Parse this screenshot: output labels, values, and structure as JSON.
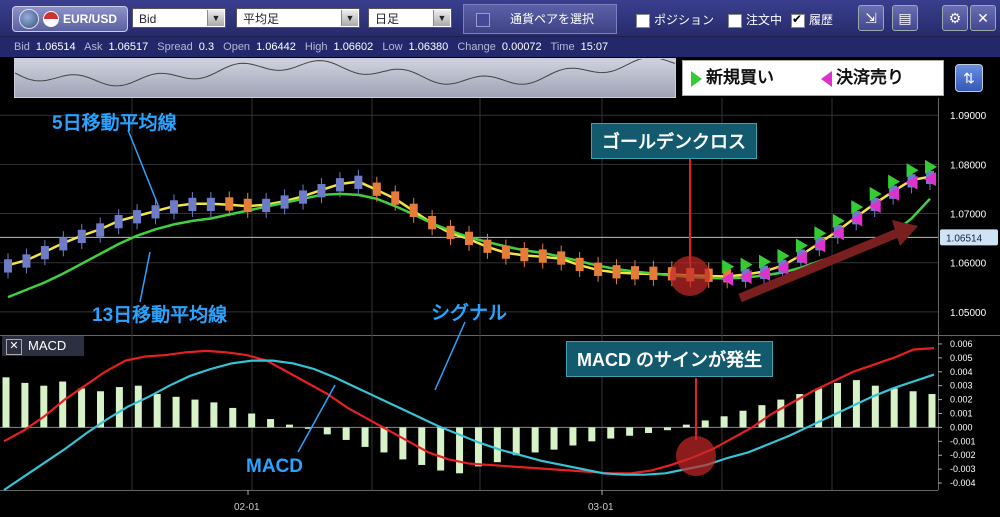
{
  "toolbar": {
    "pair": "EUR/USD",
    "price_type": "Bid",
    "chart_type": "平均足",
    "timeframe": "日足",
    "pair_select_label": "通貨ペアを選択",
    "position_label": "ポジション",
    "position_checked": false,
    "orders_label": "注文中",
    "orders_checked": false,
    "history_label": "履歴",
    "history_checked": true
  },
  "quote": {
    "bid_label": "Bid",
    "bid": "1.06514",
    "ask_label": "Ask",
    "ask": "1.06517",
    "spread_label": "Spread",
    "spread": "0.3",
    "open_label": "Open",
    "open": "1.06442",
    "high_label": "High",
    "high": "1.06602",
    "low_label": "Low",
    "low": "1.06380",
    "change_label": "Change",
    "change": "0.00072",
    "time_label": "Time",
    "time": "15:07"
  },
  "order_panel": {
    "buy_label": "新規買い",
    "sell_label": "決済売り"
  },
  "annotations": {
    "ma5": "5日移動平均線",
    "ma13": "13日移動平均線",
    "golden_cross": "ゴールデンクロス",
    "signal": "シグナル",
    "macd_sign": "MACD のサインが発生",
    "macd": "MACD"
  },
  "macd_tag": "MACD",
  "colors": {
    "up_candle": "#6e7bc9",
    "down_candle": "#e57d3a",
    "ma5": "#f2e441",
    "ma13": "#3fd13f",
    "macd_line": "#e62020",
    "signal_line": "#35c4d6",
    "histogram": "#d6f2c6",
    "buy": "#33cc33",
    "sell": "#dd33cc"
  },
  "chart_data": [
    {
      "type": "candlestick",
      "title": "",
      "y_ticks": [
        "1.09000",
        "1.08000",
        "1.07000",
        "1.06000",
        "1.05000"
      ],
      "ylim": [
        1.0455,
        1.0935
      ],
      "current_price": "1.06514",
      "series": [
        {
          "name": "5日移動平均線",
          "values": [
            1.0595,
            1.0605,
            1.0622,
            1.064,
            1.0655,
            1.0668,
            1.0685,
            1.0695,
            1.0705,
            1.0715,
            1.072,
            1.072,
            1.0718,
            1.0715,
            1.0718,
            1.0725,
            1.0735,
            1.0748,
            1.076,
            1.0765,
            1.0748,
            1.073,
            1.0705,
            1.068,
            1.066,
            1.0648,
            1.0632,
            1.062,
            1.0615,
            1.0612,
            1.0608,
            1.0595,
            1.0585,
            1.058,
            1.0578,
            1.0577,
            1.0576,
            1.0574,
            1.0573,
            1.0572,
            1.0576,
            1.0582,
            1.0594,
            1.0615,
            1.064,
            1.0665,
            1.0693,
            1.072,
            1.0745,
            1.0768,
            1.0775
          ]
        },
        {
          "name": "13日移動平均線",
          "values": [
            1.053,
            1.0545,
            1.056,
            1.0578,
            1.0598,
            1.0618,
            1.0638,
            1.0655,
            1.0668,
            1.0678,
            1.0685,
            1.069,
            1.0698,
            1.0706,
            1.0714,
            1.0722,
            1.073,
            1.0738,
            1.074,
            1.0738,
            1.073,
            1.0715,
            1.0698,
            1.068,
            1.0665,
            1.0652,
            1.0642,
            1.0633,
            1.0625,
            1.062,
            1.0612,
            1.0603,
            1.0594,
            1.0587,
            1.0582,
            1.0578,
            1.0574,
            1.0571,
            1.0569,
            1.0568,
            1.057,
            1.0574,
            1.058,
            1.059,
            1.0603,
            1.0615,
            1.0628,
            1.0642,
            1.066,
            1.069,
            1.073
          ]
        }
      ]
    },
    {
      "type": "bar",
      "title": "MACD",
      "x_ticks": [
        "02-01",
        "03-01"
      ],
      "y_ticks": [
        "0.006",
        "0.005",
        "0.004",
        "0.003",
        "0.002",
        "0.001",
        "0.000",
        "-0.001",
        "-0.002",
        "-0.003",
        "-0.004"
      ],
      "ylim": [
        -0.0045,
        0.0065
      ],
      "histogram": [
        0.0036,
        0.0032,
        0.003,
        0.0033,
        0.0028,
        0.0026,
        0.0029,
        0.003,
        0.0024,
        0.0022,
        0.002,
        0.0018,
        0.0014,
        0.001,
        0.0006,
        0.0002,
        -0.0001,
        -0.0005,
        -0.0009,
        -0.0014,
        -0.0018,
        -0.0023,
        -0.0027,
        -0.0031,
        -0.0033,
        -0.0028,
        -0.0025,
        -0.002,
        -0.0018,
        -0.0016,
        -0.0013,
        -0.001,
        -0.0008,
        -0.0006,
        -0.0004,
        -0.0002,
        0.0002,
        0.0005,
        0.0008,
        0.0012,
        0.0016,
        0.002,
        0.0024,
        0.0028,
        0.0032,
        0.0034,
        0.003,
        0.0028,
        0.0026,
        0.0024
      ],
      "series": [
        {
          "name": "MACD",
          "values": [
            -0.001,
            -0.0002,
            0.0008,
            0.002,
            0.003,
            0.004,
            0.0048,
            0.0051,
            0.0052,
            0.0054,
            0.0055,
            0.0054,
            0.0052,
            0.0048,
            0.004,
            0.0032,
            0.0024,
            0.0014,
            0.0006,
            -0.0002,
            -0.001,
            -0.0018,
            -0.0023,
            -0.0026,
            -0.0027,
            -0.0028,
            -0.0029,
            -0.003,
            -0.0031,
            -0.0032,
            -0.0033,
            -0.0033,
            -0.0031,
            -0.0027,
            -0.0022,
            -0.0016,
            -0.0008,
            0.0,
            0.001,
            0.0018,
            0.0026,
            0.0033,
            0.004,
            0.0045,
            0.005,
            0.0056,
            0.0057
          ]
        },
        {
          "name": "シグナル",
          "values": [
            -0.0045,
            -0.0035,
            -0.0025,
            -0.0015,
            -0.0004,
            0.0006,
            0.0015,
            0.0022,
            0.003,
            0.0037,
            0.0042,
            0.0046,
            0.0048,
            0.0048,
            0.0046,
            0.0042,
            0.0036,
            0.0029,
            0.0022,
            0.0015,
            0.0008,
            0.0001,
            -0.0005,
            -0.0011,
            -0.0016,
            -0.002,
            -0.0024,
            -0.0027,
            -0.003,
            -0.0033,
            -0.0034,
            -0.0034,
            -0.0033,
            -0.003,
            -0.0027,
            -0.0022,
            -0.0018,
            -0.0012,
            -0.0006,
            0.0001,
            0.0008,
            0.0015,
            0.0022,
            0.0028,
            0.0033,
            0.0038
          ]
        }
      ]
    }
  ]
}
